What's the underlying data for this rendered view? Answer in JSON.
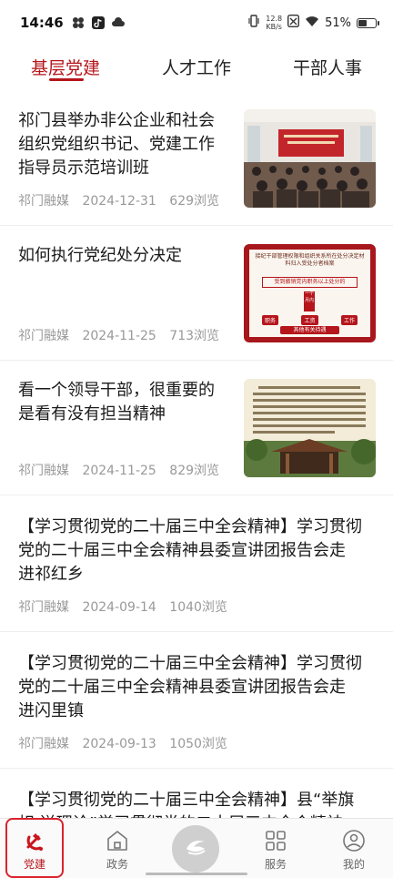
{
  "status_bar": {
    "time": "14:46",
    "net_speed_value": "12.8",
    "net_speed_unit": "KB/s",
    "battery": "51%",
    "battery_level": 0.51
  },
  "tabs": [
    {
      "label": "基层党建",
      "active": true
    },
    {
      "label": "人才工作",
      "active": false
    },
    {
      "label": "干部人事",
      "active": false
    }
  ],
  "articles": [
    {
      "title_lines": [
        "祁门县举办非公企业和社会",
        "组织党组织书记、党建工作",
        "指导员示范培训班"
      ],
      "source": "祁门融媒",
      "date": "2024-12-31",
      "views": "629浏览",
      "thumb_icon": "meeting-hall-photo"
    },
    {
      "title_lines": [
        "如何执行党纪处分决定"
      ],
      "source": "祁门融媒",
      "date": "2024-11-25",
      "views": "713浏览",
      "thumb_icon": "discipline-flowchart-graphic",
      "thumb_text": {
        "heading": "接纪干部管理权限和组织关系所在处分决定材料归入受处分者档案",
        "box": "受到撤销党内职务以上处分的",
        "column": "一个月内",
        "chips": [
          "职务",
          "工资",
          "工作"
        ],
        "bottom": "其他有关待遇"
      }
    },
    {
      "title_lines": [
        "看一个领导干部，很重要的",
        "是看有没有担当精神"
      ],
      "source": "祁门融媒",
      "date": "2024-11-25",
      "views": "829浏览",
      "thumb_icon": "text-and-pavilion-photo"
    },
    {
      "title_lines": [
        "【学习贯彻党的二十届三中全会精神】学习贯彻",
        "党的二十届三中全会精神县委宣讲团报告会走",
        "进祁红乡"
      ],
      "source": "祁门融媒",
      "date": "2024-09-14",
      "views": "1040浏览"
    },
    {
      "title_lines": [
        "【学习贯彻党的二十届三中全会精神】学习贯彻",
        "党的二十届三中全会精神县委宣讲团报告会走",
        "进闪里镇"
      ],
      "source": "祁门融媒",
      "date": "2024-09-13",
      "views": "1050浏览"
    },
    {
      "title_lines": [
        "【学习贯彻党的二十届三中全会精神】县“举旗",
        "帜 送理论”学习贯彻党的二十届三中全会精神"
      ],
      "source": "",
      "date": "",
      "views": ""
    }
  ],
  "bottom_nav": [
    {
      "label": "党建",
      "icon": "party-emblem-icon",
      "active": true
    },
    {
      "label": "政务",
      "icon": "home-icon",
      "active": false
    },
    {
      "label": "",
      "icon": "app-logo-icon",
      "active": false
    },
    {
      "label": "服务",
      "icon": "grid-icon",
      "active": false
    },
    {
      "label": "我的",
      "icon": "person-icon",
      "active": false
    }
  ],
  "colors": {
    "accent": "#b5151b",
    "meta_text": "#999999",
    "divider": "#eeeeee",
    "active_frame": "#d9232d"
  }
}
